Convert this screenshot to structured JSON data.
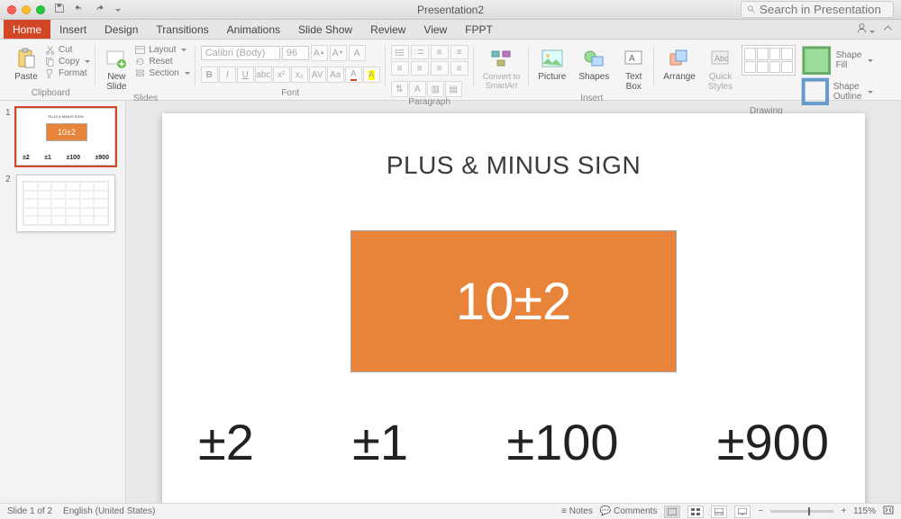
{
  "titlebar": {
    "doc_title": "Presentation2",
    "search_placeholder": "Search in Presentation"
  },
  "tabs": {
    "items": [
      "Home",
      "Insert",
      "Design",
      "Transitions",
      "Animations",
      "Slide Show",
      "Review",
      "View",
      "FPPT"
    ],
    "active_index": 0
  },
  "ribbon": {
    "clipboard": {
      "paste": "Paste",
      "cut": "Cut",
      "copy": "Copy",
      "format": "Format",
      "label": "Clipboard"
    },
    "slides": {
      "new_slide": "New\nSlide",
      "layout": "Layout",
      "reset": "Reset",
      "section": "Section",
      "label": "Slides"
    },
    "font": {
      "name": "Calibri (Body)",
      "size": "96",
      "label": "Font"
    },
    "paragraph": {
      "label": "Paragraph"
    },
    "smartart": {
      "convert": "Convert to\nSmartArt"
    },
    "insert": {
      "picture": "Picture",
      "shapes": "Shapes",
      "textbox": "Text\nBox",
      "label": "Insert"
    },
    "arrange": {
      "arrange": "Arrange",
      "quick": "Quick\nStyles",
      "fill": "Shape Fill",
      "outline": "Shape Outline",
      "label": "Drawing"
    }
  },
  "thumbnails": [
    {
      "num": "1",
      "title": "PLUS & MINUS SIGN",
      "box": "10±2",
      "values": [
        "±2",
        "±1",
        "±100",
        "±900"
      ]
    },
    {
      "num": "2"
    }
  ],
  "slide": {
    "title": "PLUS & MINUS SIGN",
    "box_text": "10±2",
    "values": [
      "±2",
      "±1",
      "±100",
      "±900"
    ]
  },
  "status": {
    "slide_info": "Slide 1 of 2",
    "language": "English (United States)",
    "notes": "Notes",
    "comments": "Comments",
    "zoom": "115%"
  }
}
